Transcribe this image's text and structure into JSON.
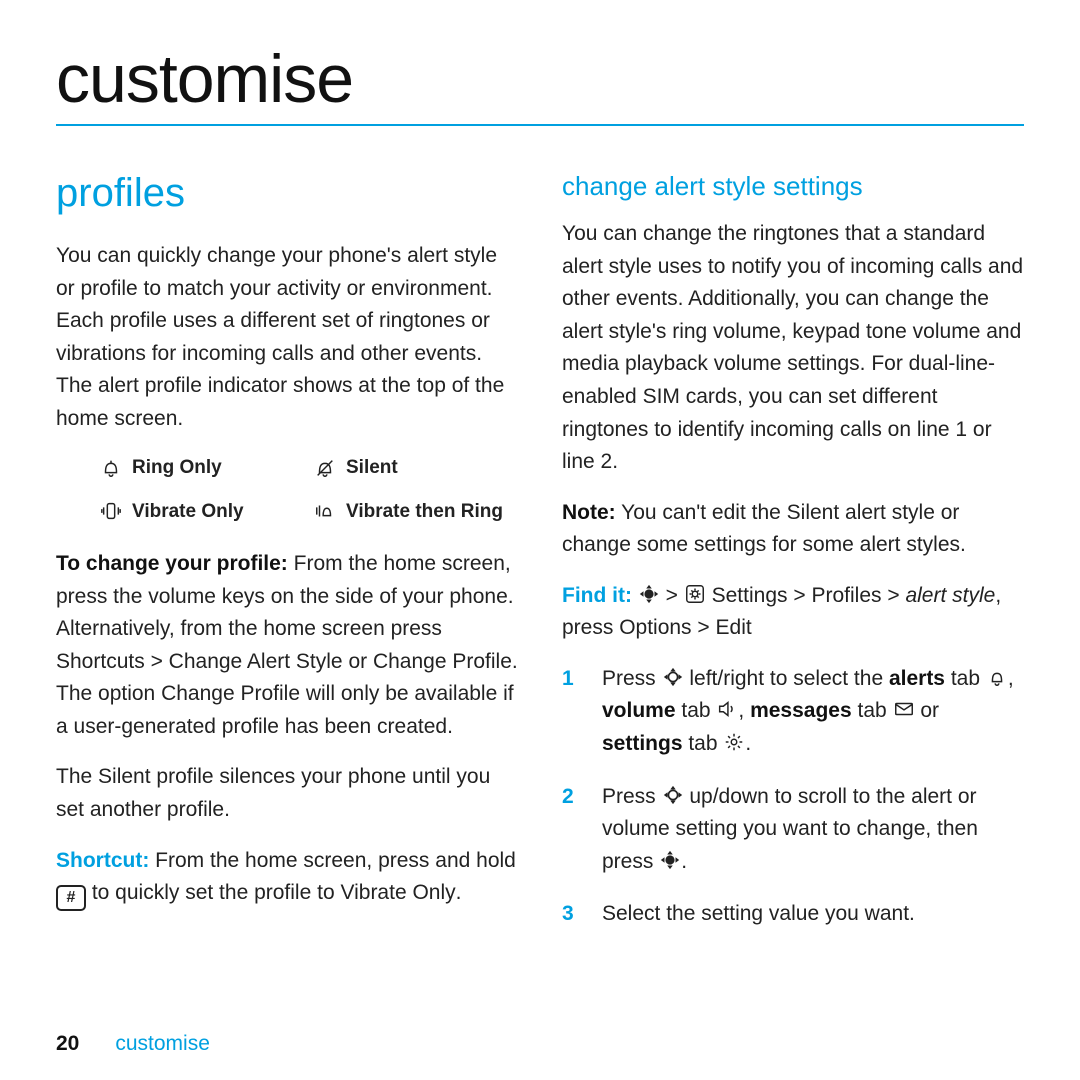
{
  "page_title": "customise",
  "footer": {
    "page_number": "20",
    "section": "customise"
  },
  "left": {
    "heading": "profiles",
    "intro": "You can quickly change your phone's alert style or profile to match your activity or environment. Each profile uses a different set of ringtones or vibrations for incoming calls and other events. The alert profile indicator shows at the top of the home screen.",
    "profiles": {
      "ring_only": "Ring Only",
      "silent": "Silent",
      "vibrate_only": "Vibrate Only",
      "vibrate_then_ring": "Vibrate then Ring"
    },
    "to_change_label": "To change your profile:",
    "to_change_text1": " From the home screen, press the volume keys on the side of your phone. Alternatively, from the home screen press ",
    "shortcuts": "Shortcuts",
    "gt": ">",
    "change_alert_style": "Change Alert Style",
    "or": " or ",
    "change_profile": "Change Profile",
    "to_change_text2": ". The option ",
    "to_change_text3": " will only be available if a user-generated profile has been created.",
    "silent_para_pre": "The ",
    "silent_word": "Silent",
    "silent_para_post": " profile silences your phone until you set another profile.",
    "shortcut_label": "Shortcut:",
    "shortcut_text_pre": " From the home screen, press and hold ",
    "hash": "#",
    "shortcut_text_post": " to quickly set the profile to ",
    "vibrate_only_word": "Vibrate Only",
    "period": "."
  },
  "right": {
    "heading": "change alert style settings",
    "intro": "You can change the ringtones that a standard alert style uses to notify you of incoming calls and other events. Additionally, you can change the alert style's ring volume, keypad tone volume and media playback volume settings. For dual-line-enabled SIM cards, you can set different ringtones to identify incoming calls on line 1 or line 2.",
    "note_label": "Note:",
    "note_text_pre": " You can't edit the ",
    "silent_word": "Silent",
    "note_text_post": " alert style or change some settings for some alert styles.",
    "find_it": "Find it:",
    "settings": "Settings",
    "profiles_word": "Profiles",
    "alert_style": "alert style",
    "press_word": "press ",
    "options": "Options",
    "edit": "Edit",
    "steps": {
      "s1_pre": "Press ",
      "s1_a": " left/right to select the ",
      "alerts": "alerts",
      "s1_b": " tab ",
      "volume": "volume",
      "s1_c": " tab ",
      "messages": "messages",
      "s1_d": " tab ",
      "s1_e": " or ",
      "settings_tab": "settings",
      "s1_f": " tab ",
      "s2_pre": "Press ",
      "s2_a": " up/down to scroll to the alert or volume setting you want to change, then press ",
      "s3": "Select the setting value you want."
    },
    "nums": {
      "n1": "1",
      "n2": "2",
      "n3": "3"
    }
  }
}
